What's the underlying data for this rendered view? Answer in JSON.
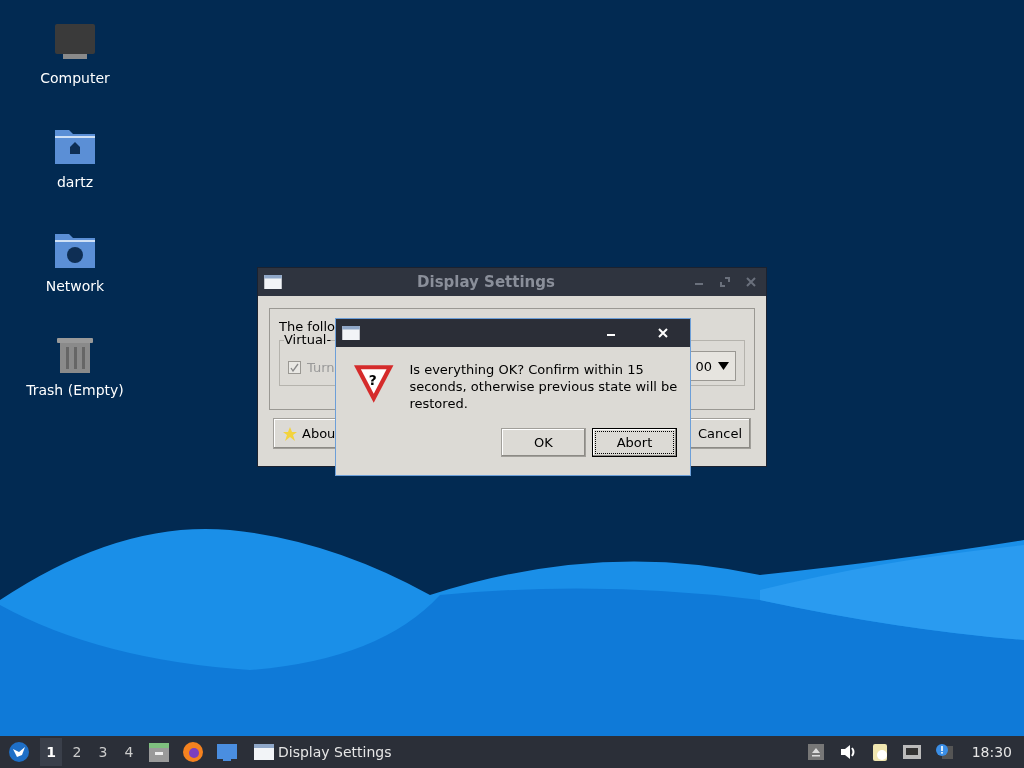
{
  "desktop_icons": [
    {
      "label": "Computer",
      "kind": "computer"
    },
    {
      "label": "dartz",
      "kind": "home"
    },
    {
      "label": "Network",
      "kind": "network"
    },
    {
      "label": "Trash (Empty)",
      "kind": "trash"
    }
  ],
  "back_window": {
    "title": "Display Settings",
    "message": "The follo",
    "group_label": "Virtual-",
    "checkbox": {
      "label": "Turn",
      "checked": true
    },
    "combo_value": "00",
    "buttons": [
      {
        "label": "Abou",
        "kind": "about"
      },
      {
        "label": "Cancel",
        "kind": "cancel"
      }
    ]
  },
  "dialog": {
    "icon_symbol": "?",
    "message": "Is everything OK? Confirm within 15 seconds, otherwise previous state will be restored.",
    "buttons": [
      {
        "label": "OK",
        "focused": false
      },
      {
        "label": "Abort",
        "focused": true
      }
    ]
  },
  "taskbar": {
    "workspaces": [
      {
        "label": "1",
        "selected": true
      },
      {
        "label": "2",
        "selected": false
      },
      {
        "label": "3",
        "selected": false
      },
      {
        "label": "4",
        "selected": false
      }
    ],
    "launchers": [
      {
        "kind": "files"
      },
      {
        "kind": "browser"
      },
      {
        "kind": "desktop"
      }
    ],
    "task": {
      "title": "Display Settings"
    },
    "tray": [
      {
        "kind": "eject"
      },
      {
        "kind": "volume"
      },
      {
        "kind": "clipboard"
      },
      {
        "kind": "network"
      },
      {
        "kind": "notification"
      }
    ],
    "clock": "18:30"
  }
}
